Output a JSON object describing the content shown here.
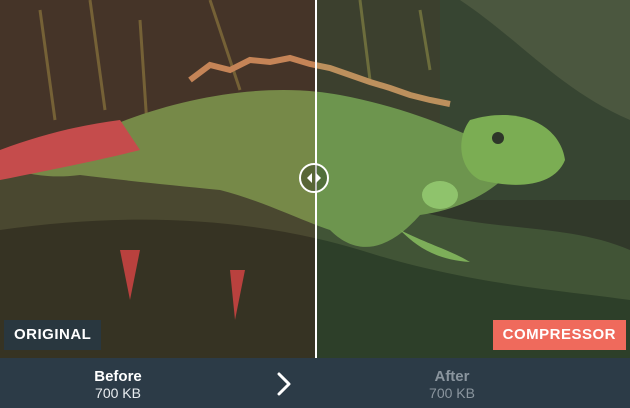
{
  "badges": {
    "left": "ORIGINAL",
    "right": "COMPRESSOR"
  },
  "footer": {
    "before": {
      "label": "Before",
      "size": "700 KB"
    },
    "after": {
      "label": "After",
      "size": "700 KB"
    }
  },
  "colors": {
    "accent": "#ef6a5c",
    "footer_bg": "#2c3b47",
    "original_badge_bg": "#283742",
    "muted_text": "#8a959e"
  },
  "icons": {
    "compare_handle": "left-right-arrows-icon",
    "next": "chevron-right-icon"
  }
}
